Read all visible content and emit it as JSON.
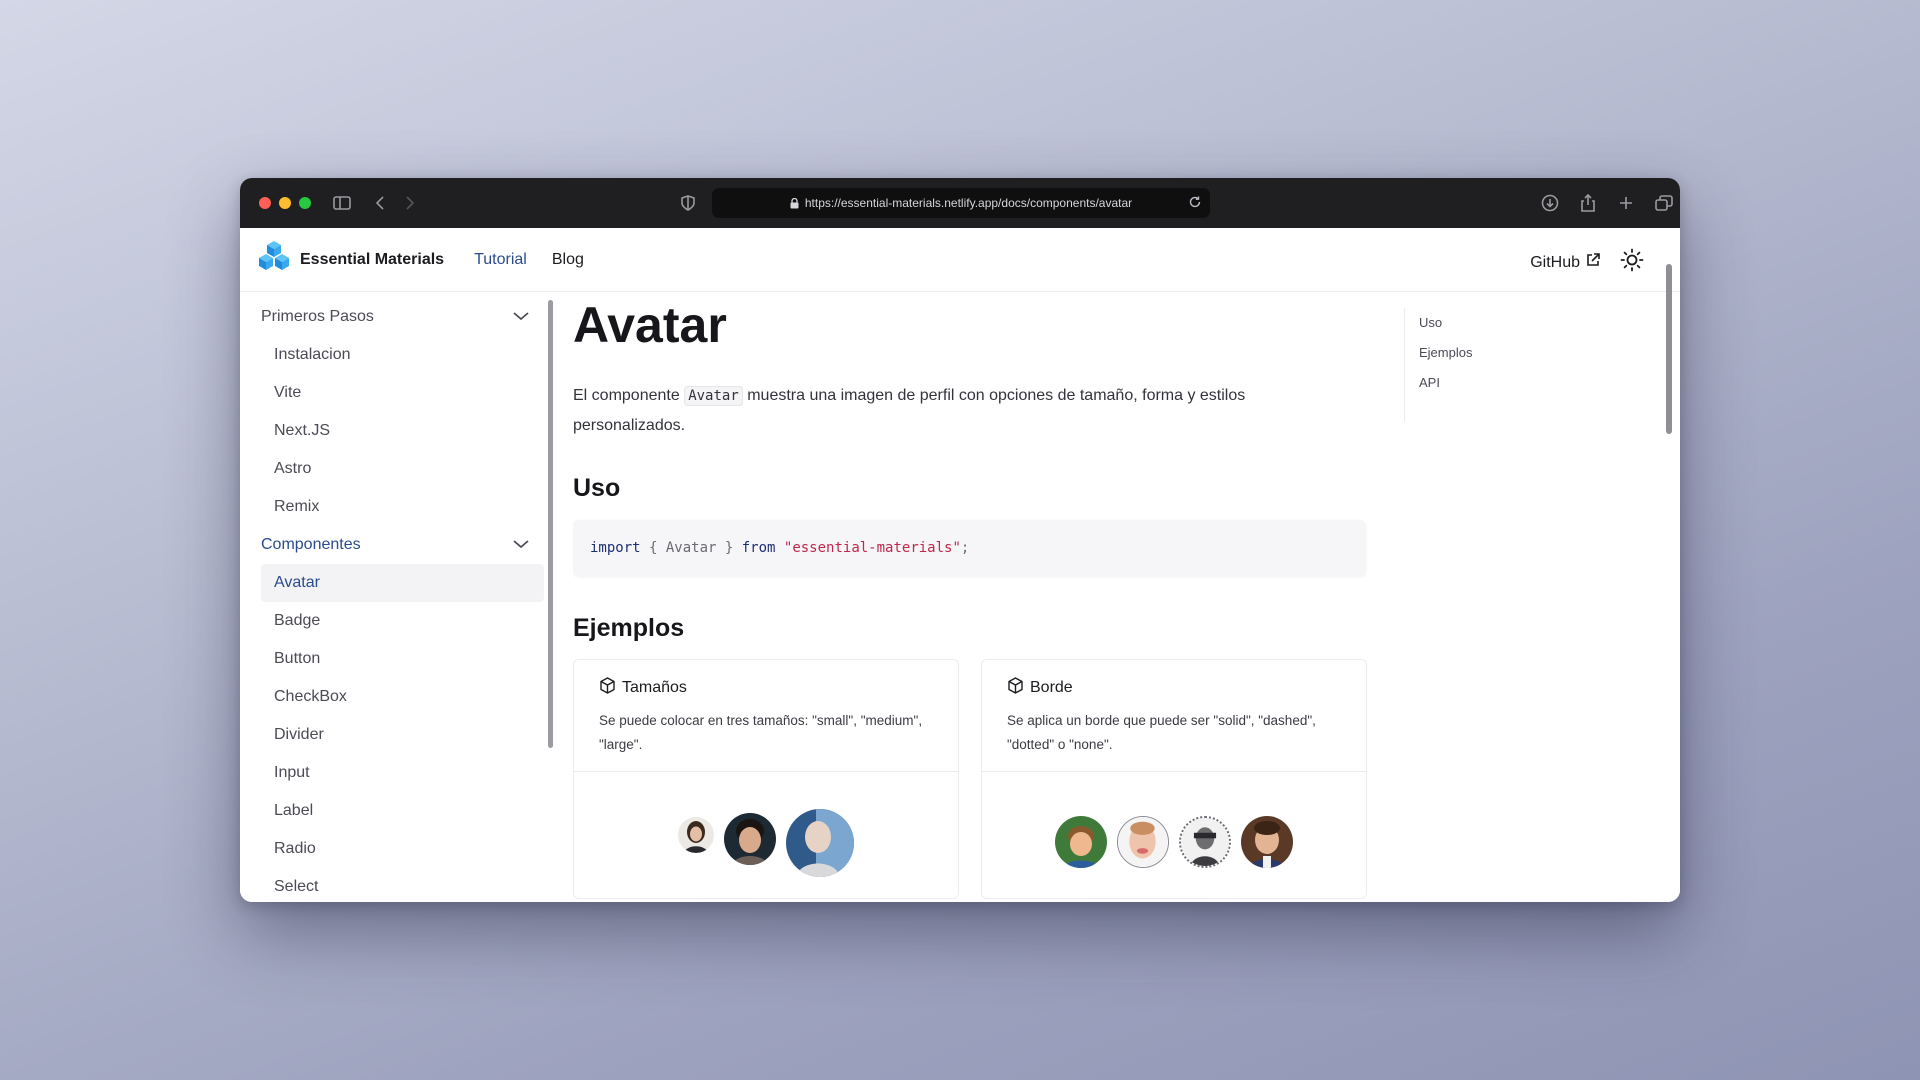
{
  "browser": {
    "url": "https://essential-materials.netlify.app/docs/components/avatar"
  },
  "header": {
    "brand": "Essential Materials",
    "nav": [
      {
        "label": "Tutorial",
        "active": true
      },
      {
        "label": "Blog",
        "active": false
      }
    ],
    "github": "GitHub"
  },
  "sidebar": {
    "sections": [
      {
        "label": "Primeros Pasos",
        "items": [
          "Instalacion",
          "Vite",
          "Next.JS",
          "Astro",
          "Remix"
        ]
      },
      {
        "label": "Componentes",
        "items": [
          "Avatar",
          "Badge",
          "Button",
          "CheckBox",
          "Divider",
          "Input",
          "Label",
          "Radio",
          "Select"
        ],
        "active_item": "Avatar"
      }
    ]
  },
  "main": {
    "title": "Avatar",
    "intro_before": "El componente ",
    "intro_code": "Avatar",
    "intro_after": " muestra una imagen de perfil con opciones de tamaño, forma y estilos personalizados.",
    "uso_heading": "Uso",
    "code": {
      "kw1": "import",
      "mid": " { Avatar } ",
      "kw2": "from",
      "str": "\"essential-materials\"",
      "end": ";"
    },
    "ejemplos_heading": "Ejemplos",
    "cards": [
      {
        "title": "Tamaños",
        "desc": "Se puede colocar en tres tamaños: \"small\", \"medium\", \"large\"."
      },
      {
        "title": "Borde",
        "desc": "Se aplica un borde que puede ser \"solid\", \"dashed\", \"dotted\" o \"none\"."
      }
    ]
  },
  "toc": [
    "Uso",
    "Ejemplos",
    "API"
  ],
  "colors": {
    "accent": "#2b4b8d",
    "string": "#c0264b",
    "keyword": "#1f2f73"
  }
}
